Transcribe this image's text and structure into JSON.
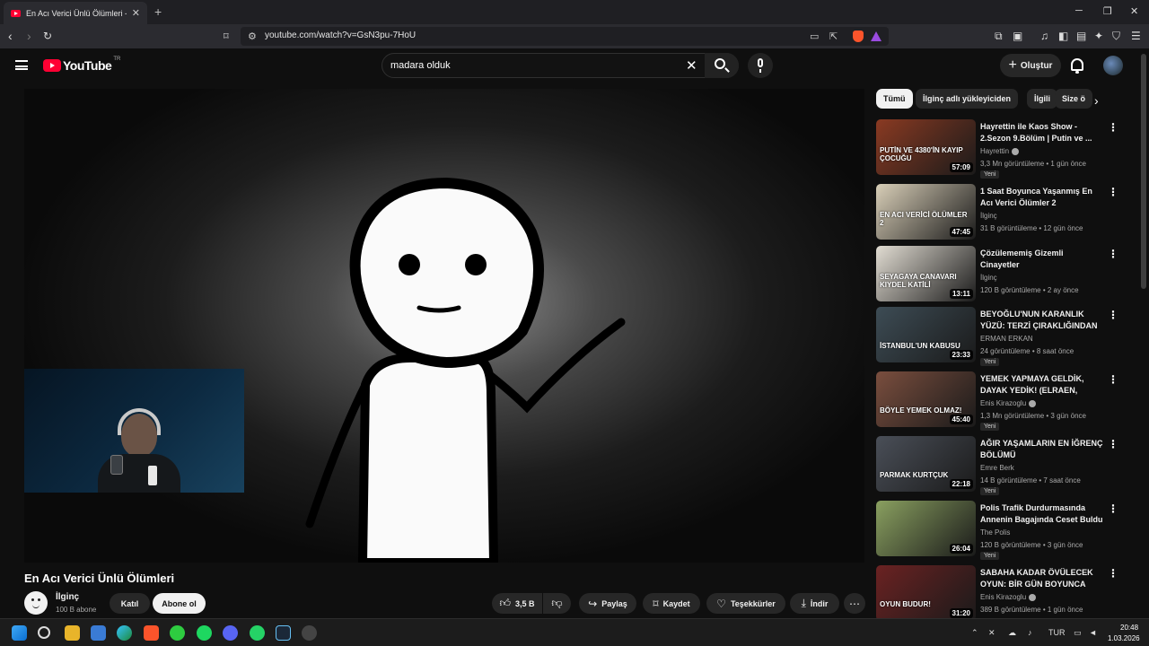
{
  "browser": {
    "tab_title": "En Acı Verici Ünlü Ölümleri - You",
    "tab_close": "✕",
    "new_tab": "+",
    "url": "youtube.com/watch?v=GsN3pu-7HoU"
  },
  "header": {
    "logo_text": "YouTube",
    "logo_country": "TR",
    "search_value": "madara olduk",
    "create_label": "Oluştur"
  },
  "video": {
    "title": "En Acı Verici Ünlü Ölümleri",
    "channel": "İlginç",
    "subscribers": "100 B abone",
    "join_label": "Katıl",
    "subscribe_label": "Abone ol",
    "likes": "3,5 B",
    "share_label": "Paylaş",
    "save_label": "Kaydet",
    "thanks_label": "Teşekkürler",
    "download_label": "İndir"
  },
  "chips": [
    "Tümü",
    "İlginç adlı yükleyiciden",
    "İlgili",
    "Size ö"
  ],
  "recommendations": [
    {
      "title": "Hayrettin ile Kaos Show - 2.Sezon 9.Bölüm | Putin ve ...",
      "channel": "Hayrettin",
      "verified": true,
      "views": "3,3 Mn görüntüleme",
      "age": "1 gün önce",
      "badge": "Yeni",
      "duration": "57:09",
      "thumb_color": "#8a3a22",
      "thumb_text": "PUTİN VE 4380'İN KAYIP ÇOCUĞU"
    },
    {
      "title": "1 Saat Boyunca Yaşanmış En Acı Verici Ölümler 2",
      "channel": "İlginç",
      "verified": false,
      "views": "31 B görüntüleme",
      "age": "12 gün önce",
      "badge": "",
      "duration": "47:45",
      "thumb_color": "#d9cfb8",
      "thumb_text": "EN ACI VERİCİ ÖLÜMLER 2"
    },
    {
      "title": "Çözülememiş Gizemli Cinayetler",
      "channel": "İlginç",
      "verified": false,
      "views": "120 B görüntüleme",
      "age": "2 ay önce",
      "badge": "",
      "duration": "13:11",
      "thumb_color": "#e2ddd3",
      "thumb_text": "SEYAGAYA CANAVARI   KIYDEL KATİLİ"
    },
    {
      "title": "BEYOĞLU'NUN KARANLIK YÜZÜ: TERZİ ÇIRAKLIĞINDAN ...",
      "channel": "ERMAN ERKAN",
      "verified": false,
      "views": "24 görüntüleme",
      "age": "8 saat önce",
      "badge": "Yeni",
      "duration": "23:33",
      "thumb_color": "#3d4c55",
      "thumb_text": "İSTANBUL'UN KABUSU"
    },
    {
      "title": "YEMEK YAPMAYA GELDİK, DAYAK YEDİK! (ELRAEN, ERAY,...",
      "channel": "Enis Kirazoglu",
      "verified": true,
      "views": "1,3 Mn görüntüleme",
      "age": "3 gün önce",
      "badge": "Yeni",
      "duration": "45:40",
      "thumb_color": "#7a4e3e",
      "thumb_text": "BÖYLE YEMEK OLMAZ!"
    },
    {
      "title": "AĞIR YAŞAMLARIN EN İĞRENÇ BÖLÜMÜ",
      "channel": "Emre Berk",
      "verified": false,
      "views": "14 B görüntüleme",
      "age": "7 saat önce",
      "badge": "Yeni",
      "duration": "22:18",
      "thumb_color": "#4a4f58",
      "thumb_text": "PARMAK   KURTÇUK"
    },
    {
      "title": "Polis Trafik Durdurmasında Annenin Bagajında Ceset Buldu",
      "channel": "The Polis",
      "verified": false,
      "views": "120 B görüntüleme",
      "age": "3 gün önce",
      "badge": "Yeni",
      "duration": "26:04",
      "thumb_color": "#8aa060",
      "thumb_text": ""
    },
    {
      "title": "SABAHA KADAR ÖVÜLECEK OYUN: BİR GÜN BOYUNCA GO...",
      "channel": "Enis Kirazoglu",
      "verified": true,
      "views": "389 B görüntüleme",
      "age": "1 gün önce",
      "badge": "",
      "duration": "31:20",
      "thumb_color": "#6b2222",
      "thumb_text": "OYUN BUDUR!"
    }
  ],
  "taskbar": {
    "lang": "TUR",
    "time": "20:48",
    "date": "1.03.2026"
  },
  "colors": {
    "brand": "#ff0033",
    "background": "#0f0f0f",
    "chip": "#272727"
  }
}
